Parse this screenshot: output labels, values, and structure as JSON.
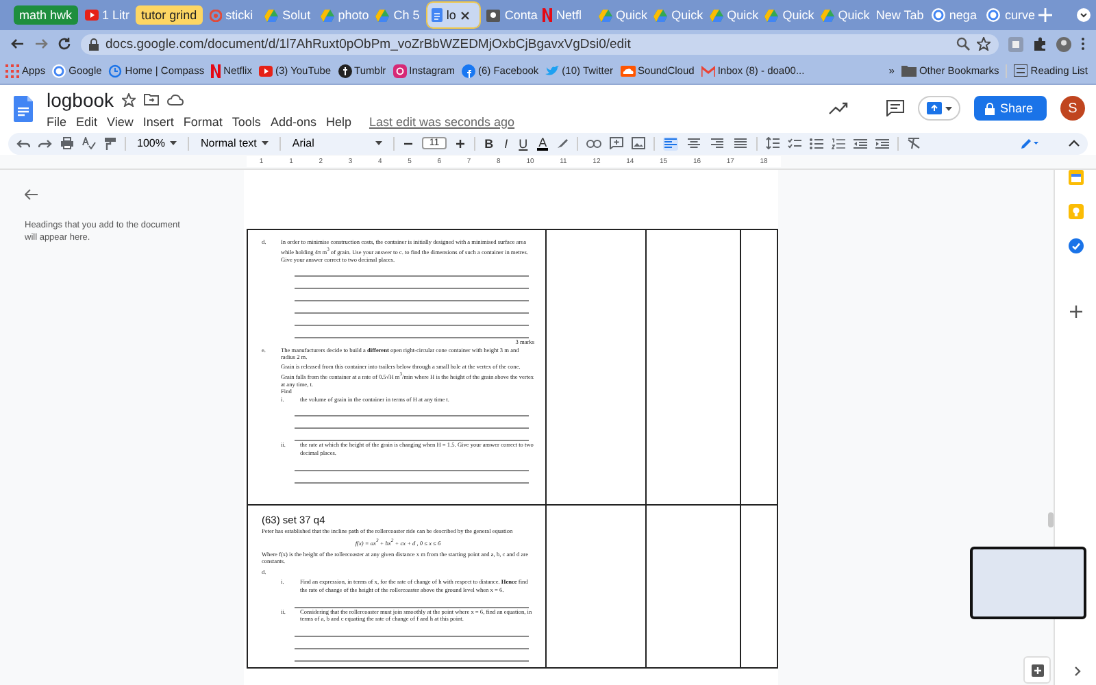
{
  "browser": {
    "tabs": [
      {
        "label": "math hwk",
        "kind": "group",
        "color": "#1e8e3e",
        "selected": false
      },
      {
        "label": "1 Litr",
        "kind": "youtube",
        "selected": false
      },
      {
        "label": "tutor grind",
        "kind": "group",
        "color": "#fdd663",
        "selected": false
      },
      {
        "label": "sticki",
        "kind": "target",
        "selected": false
      },
      {
        "label": "Solut",
        "kind": "drive",
        "selected": false
      },
      {
        "label": "photo",
        "kind": "drive",
        "selected": false
      },
      {
        "label": "Ch 5",
        "kind": "drive",
        "selected": false
      },
      {
        "label": "lo",
        "kind": "docs",
        "selected": true
      },
      {
        "label": "Conta",
        "kind": "contacts",
        "selected": false
      },
      {
        "label": "Netfl",
        "kind": "netflix",
        "selected": false
      },
      {
        "label": "Quick",
        "kind": "drive",
        "selected": false
      },
      {
        "label": "Quick",
        "kind": "drive",
        "selected": false
      },
      {
        "label": "Quick",
        "kind": "drive",
        "selected": false
      },
      {
        "label": "Quick",
        "kind": "drive",
        "selected": false
      },
      {
        "label": "Quick",
        "kind": "drive",
        "selected": false
      },
      {
        "label": "New Tab",
        "kind": "plain",
        "selected": false
      },
      {
        "label": "nega",
        "kind": "google",
        "selected": false
      },
      {
        "label": "curve",
        "kind": "google",
        "selected": false
      }
    ],
    "url": "docs.google.com/document/d/1l7AhRuxt0pObPm_voZrBbWZEDMjOxbCjBgavxVgDsi0/edit",
    "bookmarks": [
      {
        "label": "Apps",
        "kind": "apps"
      },
      {
        "label": "Google",
        "kind": "google"
      },
      {
        "label": "Home | Compass",
        "kind": "compass"
      },
      {
        "label": "Netflix",
        "kind": "netflix"
      },
      {
        "label": "(3) YouTube",
        "kind": "youtube"
      },
      {
        "label": "Tumblr",
        "kind": "tumblr"
      },
      {
        "label": "Instagram",
        "kind": "instagram"
      },
      {
        "label": "(6) Facebook",
        "kind": "facebook"
      },
      {
        "label": "(10) Twitter",
        "kind": "twitter"
      },
      {
        "label": "SoundCloud",
        "kind": "soundcloud"
      },
      {
        "label": "Inbox (8) - doa00...",
        "kind": "gmail"
      }
    ],
    "more": "»",
    "other_bookmarks": "Other Bookmarks",
    "reading_list": "Reading List"
  },
  "docs": {
    "title": "logbook",
    "menu": [
      "File",
      "Edit",
      "View",
      "Insert",
      "Format",
      "Tools",
      "Add-ons",
      "Help"
    ],
    "last_edit": "Last edit was seconds ago",
    "share": "Share",
    "avatar": "S"
  },
  "toolbar": {
    "zoom": "100%",
    "style": "Normal text",
    "font": "Arial",
    "font_size": "11",
    "format_buttons": [
      "B",
      "I",
      "U",
      "A"
    ],
    "alignment": [
      {
        "kind": "left",
        "selected": true
      },
      {
        "kind": "center",
        "selected": false
      },
      {
        "kind": "right",
        "selected": false
      },
      {
        "kind": "justify",
        "selected": false
      }
    ]
  },
  "ruler": [
    "1",
    "1",
    "2",
    "3",
    "4",
    "5",
    "6",
    "7",
    "8",
    "10",
    "11",
    "12",
    "14",
    "15",
    "16",
    "17",
    "18"
  ],
  "outline": {
    "hint": "Headings that you add to the document will appear here."
  },
  "document": {
    "cells": [
      {
        "blocks": [
          {
            "kind": "item",
            "marker": "d.",
            "text": "In order to minimise construction costs, the container is initially designed with a minimised surface area while holding 4π m$^{3}$ of grain. Use your answer to c. to find the dimensions of such a container in metres. Give your answer correct to two decimal places."
          },
          {
            "kind": "rule"
          },
          {
            "kind": "rule"
          },
          {
            "kind": "rule"
          },
          {
            "kind": "rule"
          },
          {
            "kind": "rule"
          },
          {
            "kind": "rule"
          },
          {
            "kind": "marks",
            "text": "3 marks"
          },
          {
            "kind": "item",
            "marker": "e.",
            "text": "The manufacturers decide to build a **different** open right-circular cone container with height 3 m and radius 2 m."
          },
          {
            "kind": "text",
            "text": "Grain is released from this container into trailers below through a small hole at the vertex of the cone. Grain falls from the container at a rate of 0.5√H m$^{3}$/min where H is the height of the grain above the vertex at any time, t."
          },
          {
            "kind": "text",
            "text": "Find"
          },
          {
            "kind": "sub",
            "marker": "i.",
            "text": "the volume of grain in the container in terms of H at any time t."
          },
          {
            "kind": "rule"
          },
          {
            "kind": "rule"
          },
          {
            "kind": "rule"
          },
          {
            "kind": "sub",
            "marker": "ii.",
            "text": "the rate at which the height of the grain is changing when H = 1.5.  Give your answer correct to two decimal places."
          },
          {
            "kind": "rule"
          },
          {
            "kind": "rule"
          }
        ]
      },
      {
        "blocks": [
          {
            "kind": "heading",
            "text": "(63) set 37 q4"
          },
          {
            "kind": "plain",
            "text": "Peter has established that the incline path of the rollercoaster ride can be described by the general equation"
          },
          {
            "kind": "equation",
            "text": "f(x) = ax$^{3}$ + bx$^{2}$ + cx + d ,  0 ≤ x ≤ 6"
          },
          {
            "kind": "plain",
            "text": "Where f(x) is the height of the rollercoaster at any given distance x m from the starting point and a, b, c and d are constants."
          },
          {
            "kind": "plain",
            "text": "d."
          },
          {
            "kind": "sub",
            "marker": "i.",
            "text": "Find an expression, in terms of x, for the rate of change of h with respect to distance.  **Hence** find the rate of change of the height of the rollercoaster above the ground level when x = 6."
          },
          {
            "kind": "rule"
          },
          {
            "kind": "sub",
            "marker": "ii.",
            "text": "Considering that the rollercoaster must join smoothly at the point where x = 6, find an equation, in terms of a, b and c equating the rate of change of f and h at this point."
          },
          {
            "kind": "rule"
          },
          {
            "kind": "rule"
          },
          {
            "kind": "rule"
          }
        ]
      }
    ]
  }
}
